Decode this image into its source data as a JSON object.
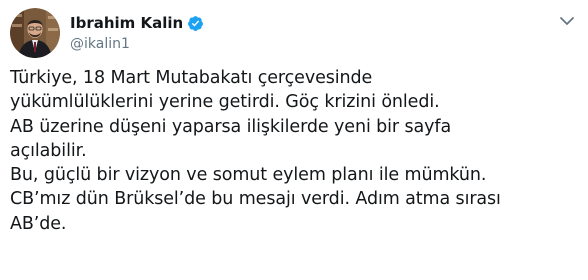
{
  "tweet": {
    "author": {
      "display_name": "Ibrahim Kalin",
      "handle": "@ikalin1",
      "verified": true,
      "avatar_icon": "profile-photo"
    },
    "menu_icon": "chevron-down-icon",
    "text_lines": [
      "Türkiye, 18 Mart Mutabakatı çerçevesinde",
      "yükümlülüklerini yerine getirdi. Göç krizini önledi.",
      "AB üzerine düşeni yaparsa ilişkilerde yeni bir sayfa",
      "açılabilir.",
      "Bu, güçlü bir vizyon ve somut eylem planı ile mümkün.",
      "CB’mız dün Brüksel’de bu mesajı verdi. Adım atma sırası",
      "AB’de."
    ],
    "colors": {
      "text": "#14171a",
      "secondary": "#657786",
      "verified_badge": "#1da1f2"
    }
  }
}
